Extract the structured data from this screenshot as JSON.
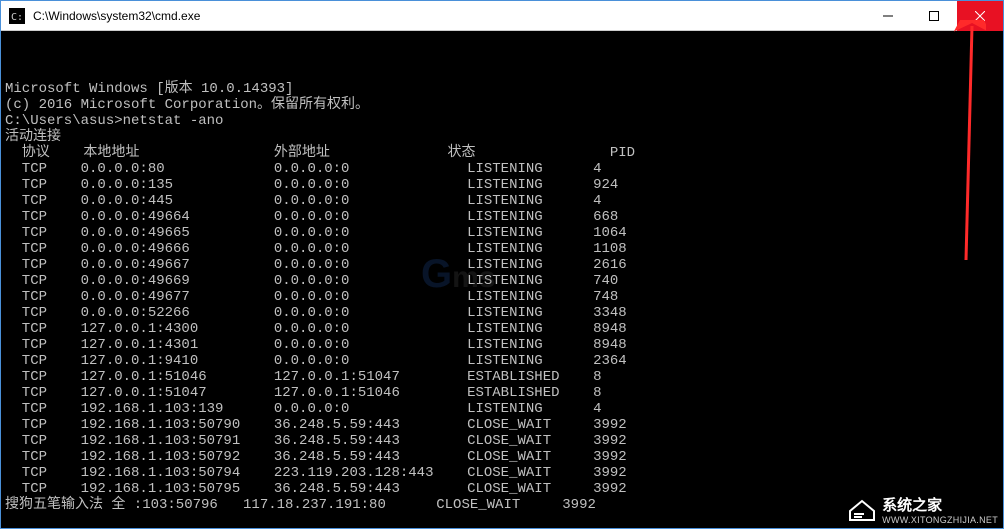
{
  "window": {
    "title": "C:\\Windows\\system32\\cmd.exe"
  },
  "terminal": {
    "header1": "Microsoft Windows [版本 10.0.14393]",
    "header2": "(c) 2016 Microsoft Corporation。保留所有权利。",
    "prompt_path": "C:\\Users\\asus>",
    "command": "netstat -ano",
    "section_title": "活动连接",
    "columns": {
      "proto": "协议",
      "local": "本地地址",
      "foreign": "外部地址",
      "state": "状态",
      "pid": "PID"
    },
    "rows": [
      {
        "proto": "TCP",
        "local": "0.0.0.0:80",
        "foreign": "0.0.0.0:0",
        "state": "LISTENING",
        "pid": "4"
      },
      {
        "proto": "TCP",
        "local": "0.0.0.0:135",
        "foreign": "0.0.0.0:0",
        "state": "LISTENING",
        "pid": "924"
      },
      {
        "proto": "TCP",
        "local": "0.0.0.0:445",
        "foreign": "0.0.0.0:0",
        "state": "LISTENING",
        "pid": "4"
      },
      {
        "proto": "TCP",
        "local": "0.0.0.0:49664",
        "foreign": "0.0.0.0:0",
        "state": "LISTENING",
        "pid": "668"
      },
      {
        "proto": "TCP",
        "local": "0.0.0.0:49665",
        "foreign": "0.0.0.0:0",
        "state": "LISTENING",
        "pid": "1064"
      },
      {
        "proto": "TCP",
        "local": "0.0.0.0:49666",
        "foreign": "0.0.0.0:0",
        "state": "LISTENING",
        "pid": "1108"
      },
      {
        "proto": "TCP",
        "local": "0.0.0.0:49667",
        "foreign": "0.0.0.0:0",
        "state": "LISTENING",
        "pid": "2616"
      },
      {
        "proto": "TCP",
        "local": "0.0.0.0:49669",
        "foreign": "0.0.0.0:0",
        "state": "LISTENING",
        "pid": "740"
      },
      {
        "proto": "TCP",
        "local": "0.0.0.0:49677",
        "foreign": "0.0.0.0:0",
        "state": "LISTENING",
        "pid": "748"
      },
      {
        "proto": "TCP",
        "local": "0.0.0.0:52266",
        "foreign": "0.0.0.0:0",
        "state": "LISTENING",
        "pid": "3348"
      },
      {
        "proto": "TCP",
        "local": "127.0.0.1:4300",
        "foreign": "0.0.0.0:0",
        "state": "LISTENING",
        "pid": "8948"
      },
      {
        "proto": "TCP",
        "local": "127.0.0.1:4301",
        "foreign": "0.0.0.0:0",
        "state": "LISTENING",
        "pid": "8948"
      },
      {
        "proto": "TCP",
        "local": "127.0.0.1:9410",
        "foreign": "0.0.0.0:0",
        "state": "LISTENING",
        "pid": "2364"
      },
      {
        "proto": "TCP",
        "local": "127.0.0.1:51046",
        "foreign": "127.0.0.1:51047",
        "state": "ESTABLISHED",
        "pid": "8"
      },
      {
        "proto": "TCP",
        "local": "127.0.0.1:51047",
        "foreign": "127.0.0.1:51046",
        "state": "ESTABLISHED",
        "pid": "8"
      },
      {
        "proto": "TCP",
        "local": "192.168.1.103:139",
        "foreign": "0.0.0.0:0",
        "state": "LISTENING",
        "pid": "4"
      },
      {
        "proto": "TCP",
        "local": "192.168.1.103:50790",
        "foreign": "36.248.5.59:443",
        "state": "CLOSE_WAIT",
        "pid": "3992"
      },
      {
        "proto": "TCP",
        "local": "192.168.1.103:50791",
        "foreign": "36.248.5.59:443",
        "state": "CLOSE_WAIT",
        "pid": "3992"
      },
      {
        "proto": "TCP",
        "local": "192.168.1.103:50792",
        "foreign": "36.248.5.59:443",
        "state": "CLOSE_WAIT",
        "pid": "3992"
      },
      {
        "proto": "TCP",
        "local": "192.168.1.103:50794",
        "foreign": "223.119.203.128:443",
        "state": "CLOSE_WAIT",
        "pid": "3992"
      },
      {
        "proto": "TCP",
        "local": "192.168.1.103:50795",
        "foreign": "36.248.5.59:443",
        "state": "CLOSE_WAIT",
        "pid": "3992"
      }
    ],
    "ime_prefix": "搜狗五笔输入法 全 :",
    "ime_local": "103:50796",
    "ime_foreign": "117.18.237.191:80",
    "ime_state": "CLOSE_WAIT",
    "ime_pid": "3992"
  },
  "watermark": {
    "g": "G",
    "ms": "ms"
  },
  "footer": {
    "cn": "系统之家",
    "en": "WWW.XITONGZHIJIA.NET"
  }
}
